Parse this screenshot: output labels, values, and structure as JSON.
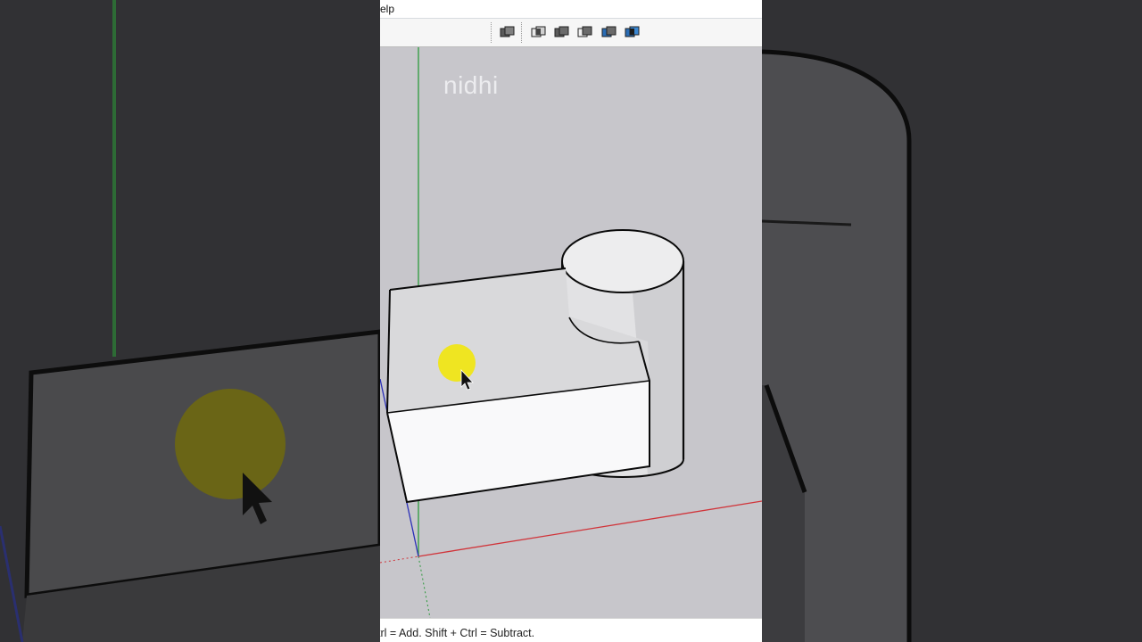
{
  "menubar": {
    "visible_text": "elp"
  },
  "toolbar": {
    "buttons": [
      {
        "icon": "outer-shell-icon"
      },
      {
        "icon": "intersect-icon"
      },
      {
        "icon": "union-icon"
      },
      {
        "icon": "subtract-icon"
      },
      {
        "icon": "trim-icon"
      },
      {
        "icon": "split-icon"
      }
    ]
  },
  "viewport": {
    "watermark": "nidhi",
    "axis_colors": {
      "green": "#2d9a3c",
      "red": "#d0343a",
      "blue": "#2a2fb8"
    },
    "click_highlight_color": "#f2e600"
  },
  "statusbar": {
    "hint_text": "trl = Add. Shift + Ctrl = Subtract."
  }
}
